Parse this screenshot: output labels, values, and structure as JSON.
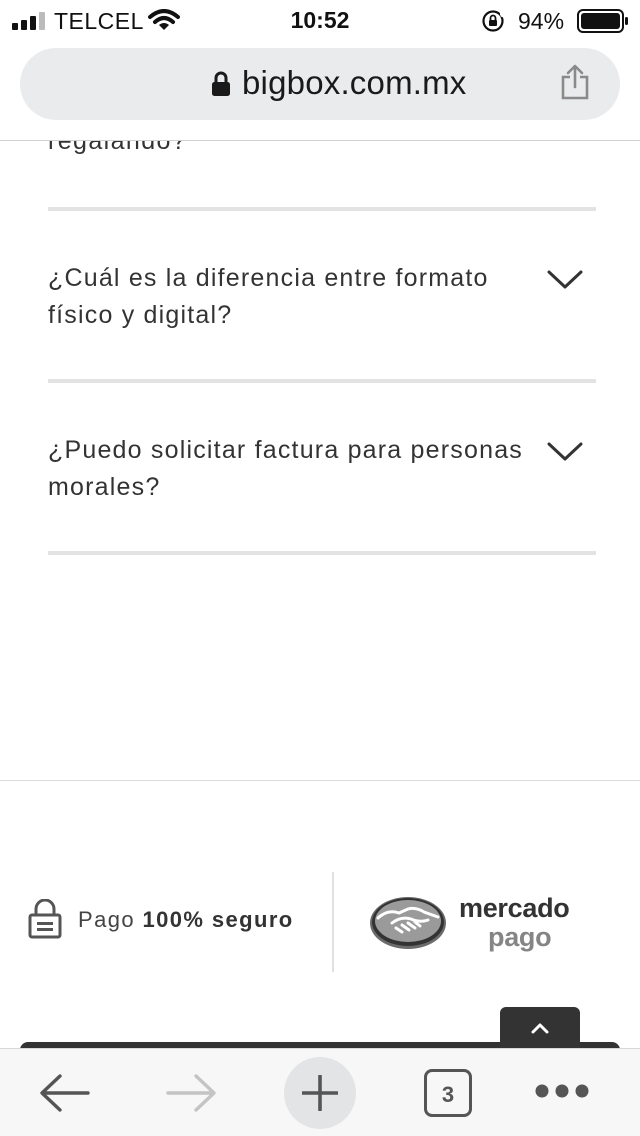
{
  "status_bar": {
    "carrier": "TELCEL",
    "time": "10:52",
    "battery_percent": "94%",
    "battery_level": 0.94,
    "icons": [
      "signal-icon",
      "wifi-icon",
      "rotation-lock-icon",
      "battery-icon"
    ]
  },
  "url_bar": {
    "domain": "bigbox.com.mx",
    "icons": [
      "lock-icon",
      "share-icon"
    ]
  },
  "faq": {
    "partial_question": "regalando?",
    "items": [
      {
        "question": "¿Cuál es la diferencia entre formato físico y digital?"
      },
      {
        "question": "¿Puedo solicitar factura para personas morales?"
      }
    ]
  },
  "payment": {
    "secure_label": "Pago",
    "secure_bold": "100% seguro",
    "brand_word1": "mercado",
    "brand_word2": "pago"
  },
  "toolbar": {
    "tab_count": "3",
    "icons": [
      "back-arrow-icon",
      "forward-arrow-icon",
      "plus-icon",
      "tabs-icon",
      "more-icon"
    ]
  },
  "colors": {
    "url_bar_bg": "#eaebec",
    "divider": "#e3e3e3",
    "dark": "#333333",
    "mercado_grey": "#858585"
  }
}
